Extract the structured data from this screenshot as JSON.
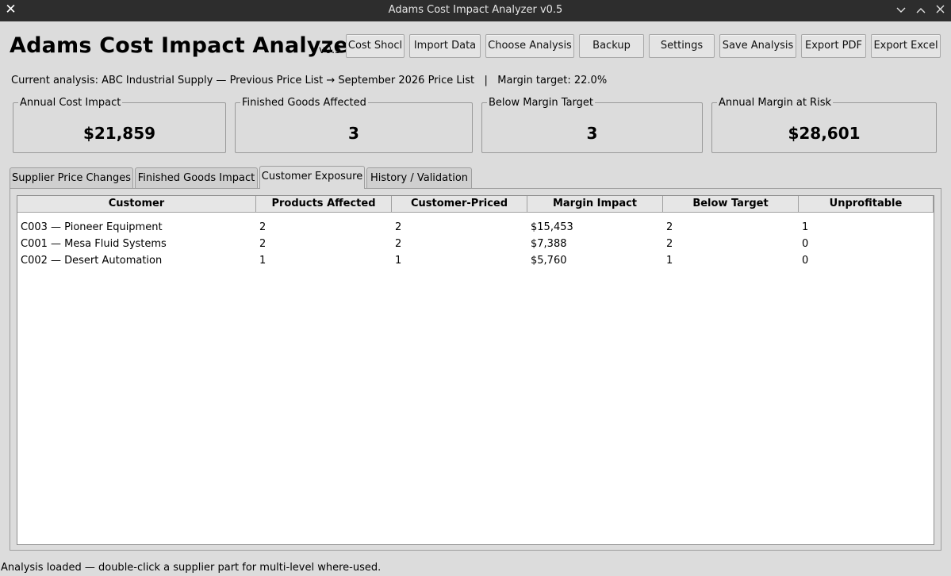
{
  "window": {
    "title": "Adams Cost Impact Analyzer v0.5",
    "icons": {
      "app": "close-x-icon",
      "minimize": "chevron-down-icon",
      "maximize": "chevron-up-icon",
      "close": "close-icon"
    }
  },
  "header": {
    "title": "Adams Cost Impact Analyzer",
    "version": "v0.5",
    "buttons": {
      "cost_shock": "Cost Shocl",
      "import_data": "Import Data",
      "choose_analysis": "Choose Analysis",
      "backup": "Backup",
      "settings": "Settings",
      "save_analysis": "Save Analysis",
      "export_pdf": "Export PDF",
      "export_excel": "Export Excel"
    }
  },
  "info": {
    "analysis_line": "Current analysis: ABC Industrial Supply — Previous Price List → September 2026 Price List   |   Margin target: 22.0%"
  },
  "summary": {
    "annual_cost_impact": {
      "label": "Annual Cost Impact",
      "value": "$21,859"
    },
    "finished_goods_affected": {
      "label": "Finished Goods Affected",
      "value": "3"
    },
    "below_margin_target": {
      "label": "Below Margin Target",
      "value": "3"
    },
    "annual_margin_at_risk": {
      "label": "Annual Margin at Risk",
      "value": "$28,601"
    }
  },
  "tabs": [
    {
      "label": "Supplier Price Changes"
    },
    {
      "label": "Finished Goods Impact"
    },
    {
      "label": "Customer Exposure"
    },
    {
      "label": "History / Validation"
    }
  ],
  "active_tab": "Customer Exposure",
  "table": {
    "columns": [
      "Customer",
      "Products Affected",
      "Customer-Priced",
      "Margin Impact",
      "Below Target",
      "Unprofitable"
    ],
    "rows": [
      [
        "C003 — Pioneer Equipment",
        "2",
        "2",
        "$15,453",
        "2",
        "1"
      ],
      [
        "C001 — Mesa Fluid Systems",
        "2",
        "2",
        "$7,388",
        "2",
        "0"
      ],
      [
        "C002 — Desert Automation",
        "1",
        "1",
        "$5,760",
        "1",
        "0"
      ]
    ]
  },
  "status": {
    "message": "Analysis loaded — double-click a supplier part for multi-level where-used."
  }
}
